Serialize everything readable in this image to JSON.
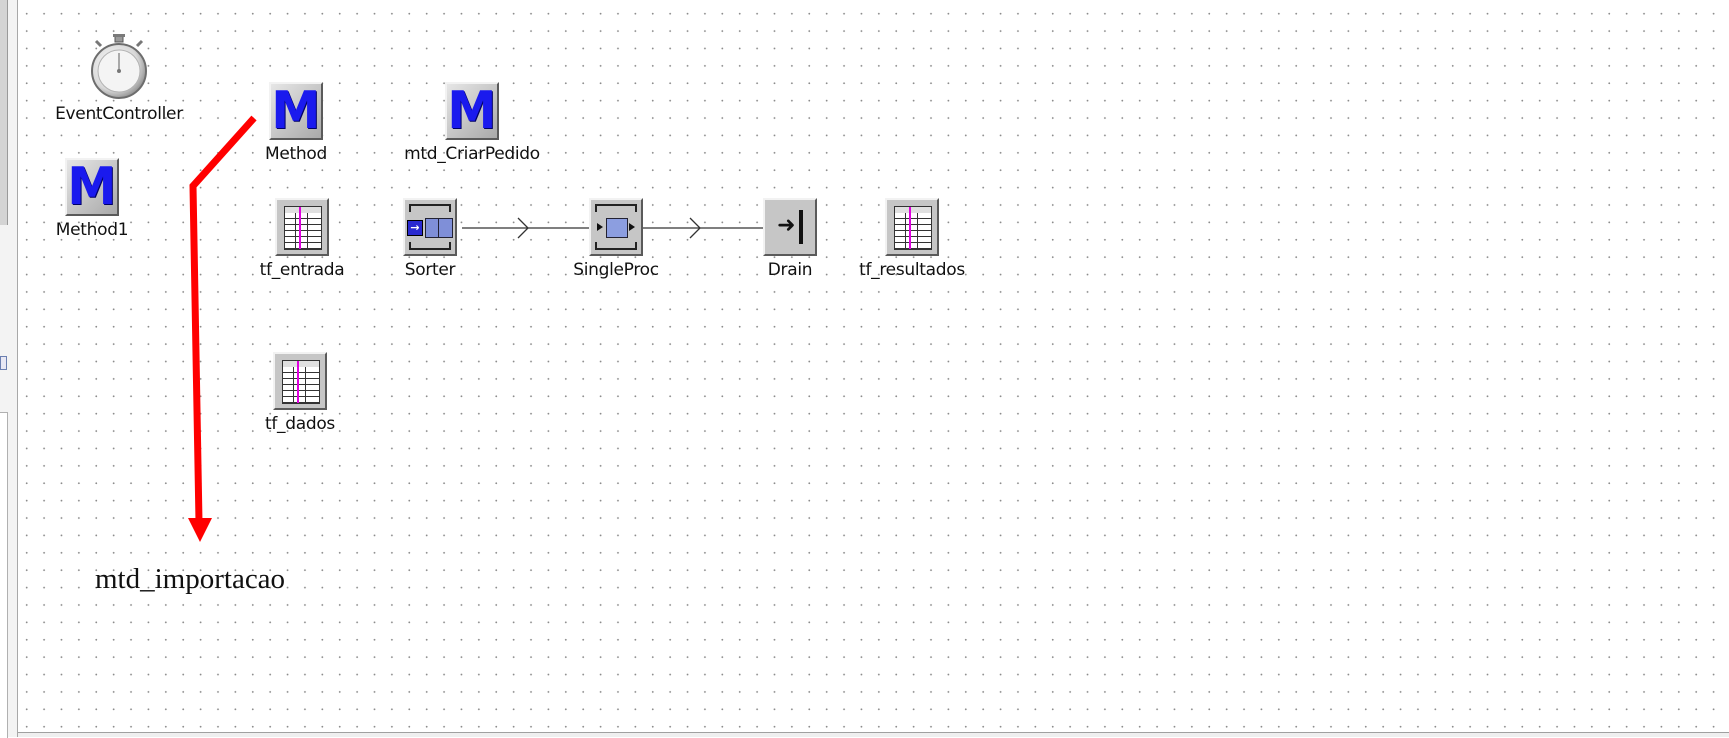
{
  "frame": {
    "objects": {
      "event_controller": "EventController",
      "method1": "Method1",
      "method": "Method",
      "mtd_criar_pedido": "mtd_CriarPedido",
      "tf_entrada": "tf_entrada",
      "sorter": "Sorter",
      "single_proc": "SingleProc",
      "drain": "Drain",
      "tf_resultados": "tf_resultados",
      "tf_dados": "tf_dados"
    },
    "icons": {
      "method": "M"
    }
  },
  "annotation": {
    "text": "mtd_importacao",
    "arrow_color": "#ff0000"
  },
  "colors": {
    "method_letter": "#1a1aee",
    "grid_dot": "#8c8c8c",
    "connector": "#333333"
  }
}
